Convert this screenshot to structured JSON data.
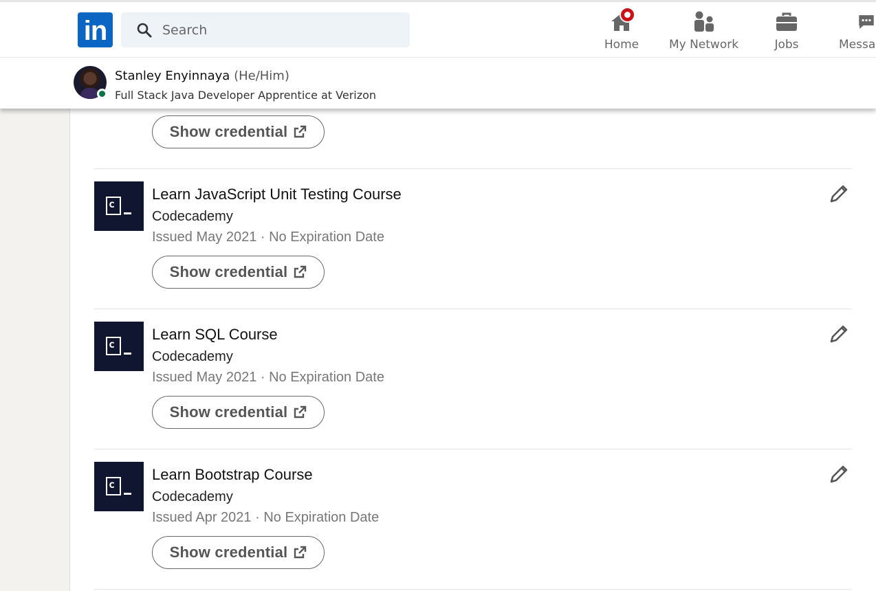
{
  "nav": {
    "logo_text": "in",
    "search_placeholder": "Search",
    "items": [
      {
        "label": "Home",
        "icon": "home-icon"
      },
      {
        "label": "My Network",
        "icon": "network-icon"
      },
      {
        "label": "Jobs",
        "icon": "briefcase-icon"
      },
      {
        "label": "Messag",
        "icon": "messaging-icon"
      }
    ]
  },
  "profile": {
    "name": "Stanley Enyinnaya",
    "pronouns": "(He/Him)",
    "headline": "Full Stack Java Developer Apprentice at Verizon"
  },
  "show_credential_label": "Show credential",
  "certifications": [
    {
      "title": "Learn JavaScript Unit Testing Course",
      "org": "Codecademy",
      "date": "Issued May 2021 · No Expiration Date"
    },
    {
      "title": "Learn SQL Course",
      "org": "Codecademy",
      "date": "Issued May 2021 · No Expiration Date"
    },
    {
      "title": "Learn Bootstrap Course",
      "org": "Codecademy",
      "date": "Issued Apr 2021 · No Expiration Date"
    }
  ],
  "colors": {
    "brand": "#0a66c2",
    "badge": "#cc1016",
    "online": "#057642",
    "codecademy_bg": "#10162f"
  }
}
